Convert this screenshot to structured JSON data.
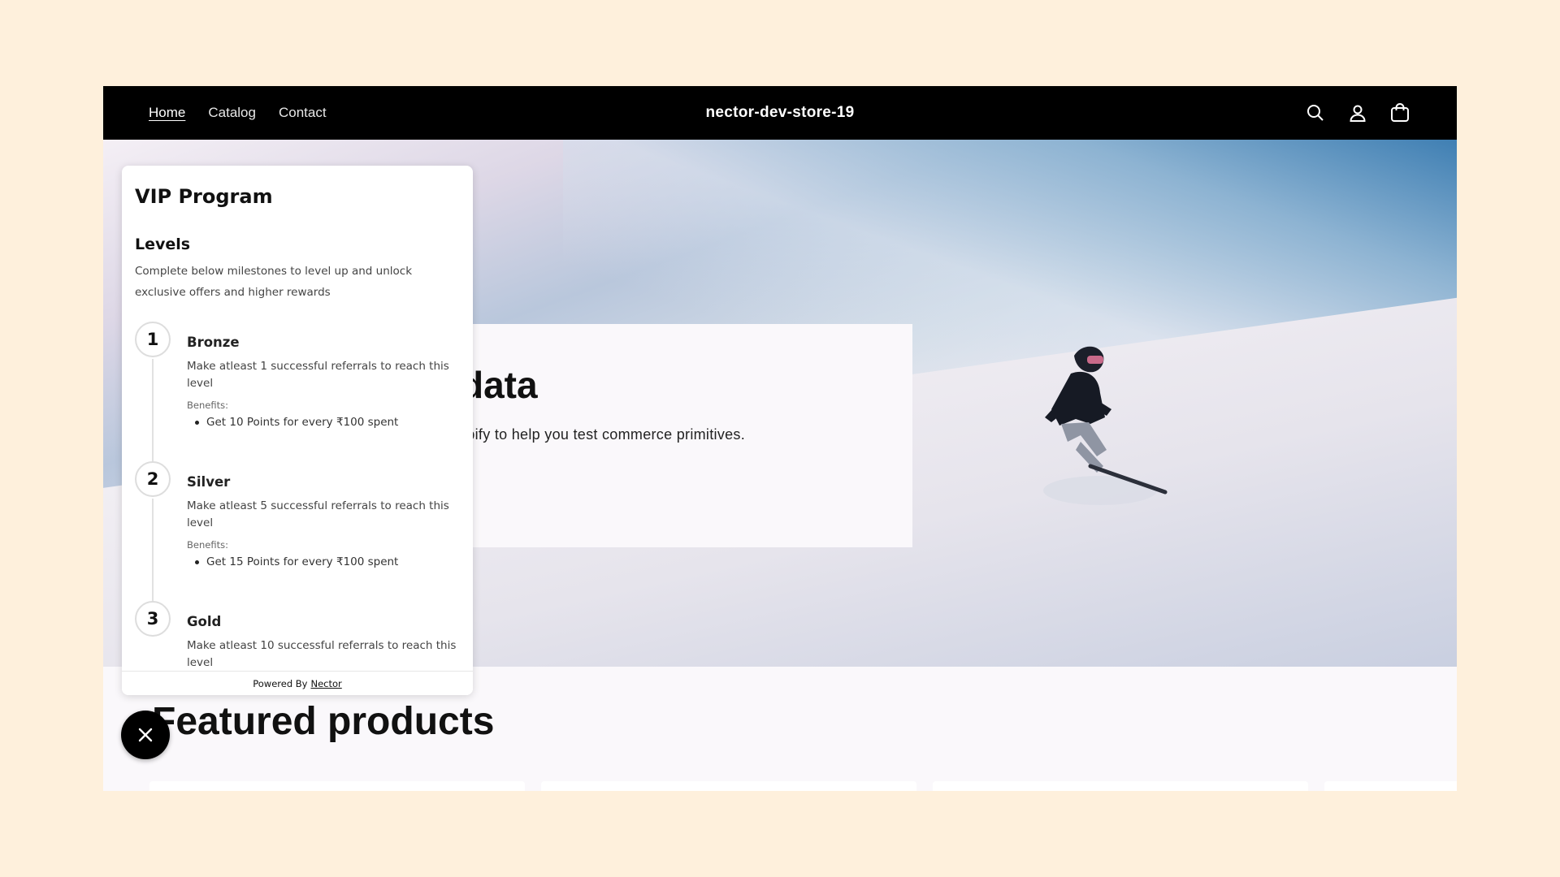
{
  "nav": {
    "links": [
      {
        "label": "Home"
      },
      {
        "label": "Catalog"
      },
      {
        "label": "Contact"
      }
    ],
    "store_title": "nector-dev-store-19",
    "icons": [
      "search-icon",
      "account-icon",
      "cart-icon"
    ]
  },
  "hero": {
    "heading_visible": "data",
    "text_visible": "opify to help you test commerce primitives."
  },
  "featured": {
    "title_visible": "Featured products"
  },
  "vip": {
    "title": "VIP Program",
    "levels_title": "Levels",
    "levels_desc": "Complete below milestones to level up and unlock exclusive offers and higher rewards",
    "levels": [
      {
        "num": "1",
        "name": "Bronze",
        "desc": "Make atleast 1 successful referrals to reach this level",
        "benefits_label": "Benefits:",
        "benefit": "Get 10 Points for every ₹100 spent"
      },
      {
        "num": "2",
        "name": "Silver",
        "desc": "Make atleast 5 successful referrals to reach this level",
        "benefits_label": "Benefits:",
        "benefit": "Get 15 Points for every ₹100 spent"
      },
      {
        "num": "3",
        "name": "Gold",
        "desc": "Make atleast 10 successful referrals to reach this level",
        "benefits_label": "",
        "benefit": ""
      }
    ],
    "footer_prefix": "Powered By",
    "footer_link": "Nector"
  },
  "colors": {
    "page_bg": "#fef0dc",
    "nav_bg": "#000000",
    "accent": "#000000"
  }
}
